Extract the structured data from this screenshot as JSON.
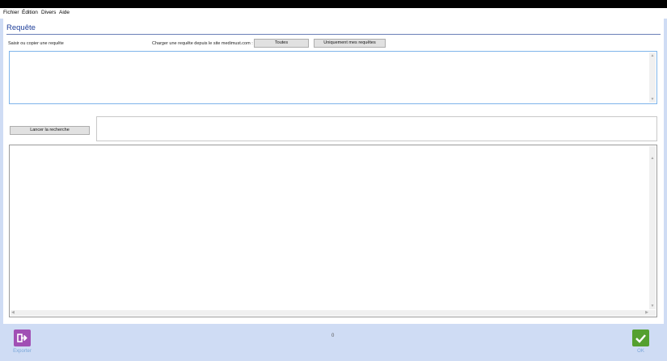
{
  "menu": {
    "items": [
      "Fichier",
      "Édition",
      "Divers",
      "Aide"
    ]
  },
  "page": {
    "title": "Requête"
  },
  "query": {
    "label": "Saisir ou copier une requête",
    "load_label": "Charger une requête depuis le site medimust.com :",
    "btn_all": "Toutes",
    "btn_mine": "Uniquement mes requêtes",
    "value": ""
  },
  "search": {
    "btn_launch": "Lancer la recherche",
    "status": ""
  },
  "results": {
    "value": ""
  },
  "footer": {
    "export_label": "Exporter",
    "ok_label": "OK",
    "counter": "0"
  },
  "colors": {
    "export": "#a14fb4",
    "ok": "#54a02f",
    "title": "#1f3f9a"
  },
  "icons": {
    "export": "exit-arrow-icon",
    "ok": "checkmark-icon"
  }
}
